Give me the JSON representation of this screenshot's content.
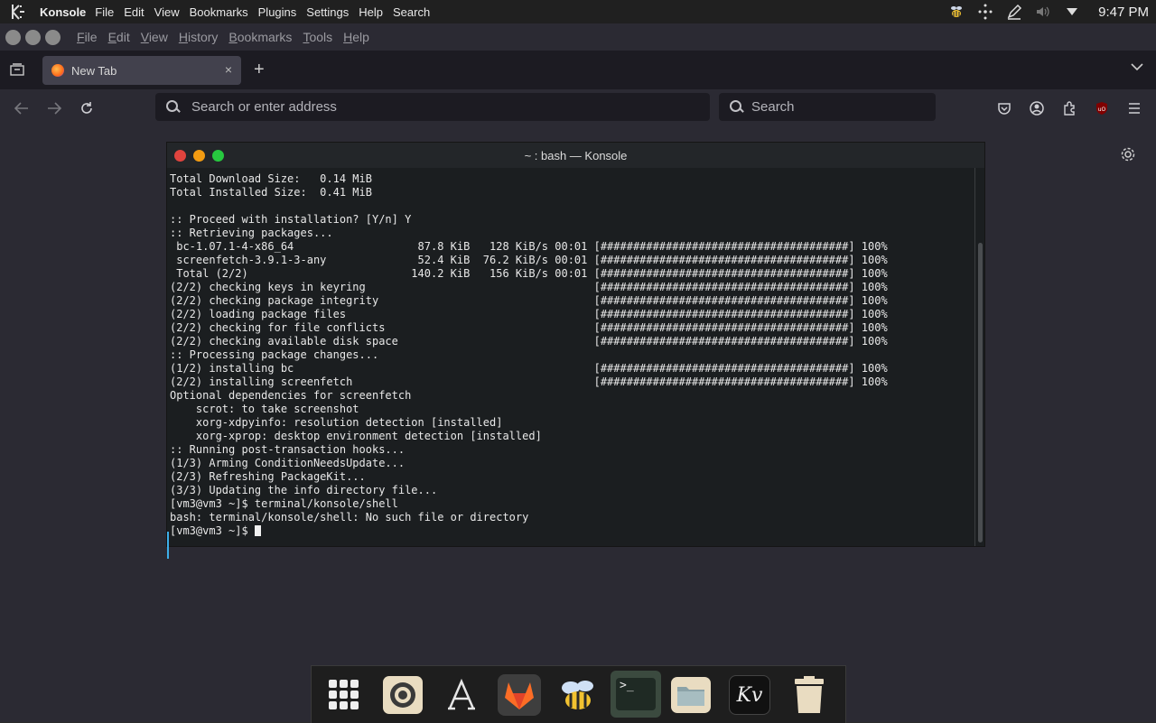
{
  "topbar": {
    "app_name": "Konsole",
    "menu": [
      "File",
      "Edit",
      "View",
      "Bookmarks",
      "Plugins",
      "Settings",
      "Help",
      "Search"
    ],
    "time": "9:47 PM",
    "tray_icons": [
      "bee-tray-icon",
      "network-icon",
      "pen-icon",
      "volume-icon",
      "arrow-down-icon"
    ]
  },
  "browser": {
    "menu": [
      "File",
      "Edit",
      "View",
      "History",
      "Bookmarks",
      "Tools",
      "Help"
    ],
    "tab": {
      "title": "New Tab",
      "close": "×"
    },
    "new_tab": "+",
    "url_placeholder": "Search or enter address",
    "search_placeholder": "Search"
  },
  "konsole": {
    "title": "~ : bash — Konsole",
    "lines": [
      "Total Download Size:   0.14 MiB",
      "Total Installed Size:  0.41 MiB",
      "",
      ":: Proceed with installation? [Y/n] Y",
      ":: Retrieving packages...",
      " bc-1.07.1-4-x86_64                   87.8 KiB   128 KiB/s 00:01 [######################################] 100%",
      " screenfetch-3.9.1-3-any              52.4 KiB  76.2 KiB/s 00:01 [######################################] 100%",
      " Total (2/2)                         140.2 KiB   156 KiB/s 00:01 [######################################] 100%",
      "(2/2) checking keys in keyring                                   [######################################] 100%",
      "(2/2) checking package integrity                                 [######################################] 100%",
      "(2/2) loading package files                                      [######################################] 100%",
      "(2/2) checking for file conflicts                                [######################################] 100%",
      "(2/2) checking available disk space                              [######################################] 100%",
      ":: Processing package changes...",
      "(1/2) installing bc                                              [######################################] 100%",
      "(2/2) installing screenfetch                                     [######################################] 100%",
      "Optional dependencies for screenfetch",
      "    scrot: to take screenshot",
      "    xorg-xdpyinfo: resolution detection [installed]",
      "    xorg-xprop: desktop environment detection [installed]",
      ":: Running post-transaction hooks...",
      "(1/3) Arming ConditionNeedsUpdate...",
      "(2/3) Refreshing PackageKit...",
      "(3/3) Updating the info directory file...",
      "[vm3@vm3 ~]$ terminal/konsole/shell",
      "bash: terminal/konsole/shell: No such file or directory"
    ],
    "prompt": "[vm3@vm3 ~]$ "
  },
  "dock": {
    "apps": [
      "app-grid-icon",
      "settings-icon",
      "font-icon",
      "gitlab-icon",
      "bee-icon",
      "terminal-icon",
      "files-icon",
      "kv-icon",
      "trash-icon"
    ],
    "kv_label": "Kv",
    "terminal_label": ">_"
  }
}
